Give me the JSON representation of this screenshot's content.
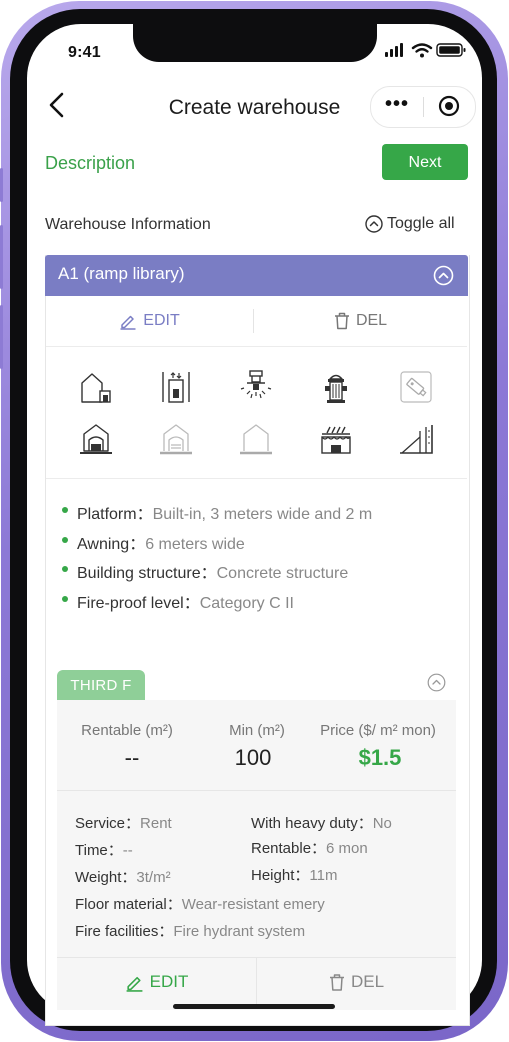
{
  "status_bar": {
    "time": "9:41"
  },
  "nav": {
    "title": "Create warehouse",
    "back_icon": "chevron-left-icon",
    "more_icon": "more-dots-icon",
    "close_icon": "target-circle-icon"
  },
  "header": {
    "section_title": "Description",
    "next_label": "Next"
  },
  "info": {
    "title": "Warehouse Information",
    "toggle_label": "Toggle all"
  },
  "warehouse": {
    "name": "A1 (ramp library)",
    "edit_label": "EDIT",
    "del_label": "DEL",
    "facility_icons": [
      "warehouse-dock-icon",
      "elevator-icon",
      "sprinkler-icon",
      "fire-hydrant-icon",
      "camera-icon",
      "garage-icon",
      "garage-outline-icon",
      "house-outline-icon",
      "awning-icon",
      "ramp-icon"
    ],
    "details": [
      {
        "label": "Platform：",
        "value": "Built-in, 3 meters wide and 2 m"
      },
      {
        "label": "Awning：",
        "value": "6 meters wide"
      },
      {
        "label": "Building structure：",
        "value": "Concrete structure"
      },
      {
        "label": "Fire-proof level：",
        "value": "Category C II"
      }
    ]
  },
  "floor": {
    "tag": "THIRD F",
    "stats": {
      "rentable_label": "Rentable (m²)",
      "rentable_value": "--",
      "min_label": "Min (m²)",
      "min_value": "100",
      "price_label": "Price ($/ m² mon)",
      "price_value": "$1.5"
    },
    "details": {
      "service_label": "Service：",
      "service_value": "Rent",
      "heavy_label": "With heavy duty：",
      "heavy_value": "No",
      "time_label": "Time：",
      "time_value": "--",
      "rentable_label": "Rentable：",
      "rentable_value": "6 mon",
      "weight_label": "Weight：",
      "weight_value": "3t/m²",
      "height_label": "Height：",
      "height_value": "11m",
      "floor_label": "Floor material：",
      "floor_value": "Wear-resistant emery",
      "fire_label": "Fire facilities：",
      "fire_value": "Fire hydrant system"
    },
    "edit_label": "EDIT",
    "del_label": "DEL"
  },
  "colors": {
    "green": "#36a748",
    "header_purple": "#7a7dc4",
    "frame": "#8c79d6"
  }
}
